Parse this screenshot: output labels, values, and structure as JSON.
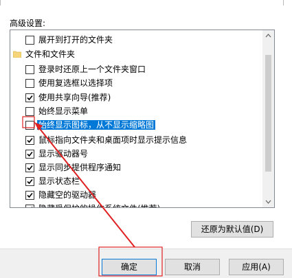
{
  "section_label": "高级设置:",
  "list_items": [
    {
      "label": "展开到打开的文件夹",
      "checked": false,
      "level": 1
    },
    {
      "label": "文件和文件夹",
      "level": 0,
      "folder": true
    },
    {
      "label": "登录时还原上一个文件夹窗口",
      "checked": false,
      "level": 1
    },
    {
      "label": "使用复选框以选择项",
      "checked": false,
      "level": 1
    },
    {
      "label": "使用共享向导(推荐)",
      "checked": true,
      "level": 1
    },
    {
      "label": "始终显示菜单",
      "checked": false,
      "level": 1
    },
    {
      "label": "始终显示图标，从不显示缩略图",
      "checked": false,
      "level": 1,
      "selected": true
    },
    {
      "label": "鼠标指向文件夹和桌面项时显示提示信息",
      "checked": true,
      "level": 1
    },
    {
      "label": "显示驱动器号",
      "checked": true,
      "level": 1
    },
    {
      "label": "显示同步提供程序通知",
      "checked": true,
      "level": 1
    },
    {
      "label": "显示状态栏",
      "checked": true,
      "level": 1
    },
    {
      "label": "隐藏空的驱动器",
      "checked": true,
      "level": 1
    },
    {
      "label": "隐藏受保护的操作系统文件(推荐)",
      "checked": true,
      "level": 1
    }
  ],
  "buttons": {
    "restore": "还原为默认值(D)",
    "ok": "确定",
    "cancel": "取消",
    "apply": "应用(A)"
  },
  "colors": {
    "selection": "#0078d7",
    "annotation": "#e02020"
  }
}
